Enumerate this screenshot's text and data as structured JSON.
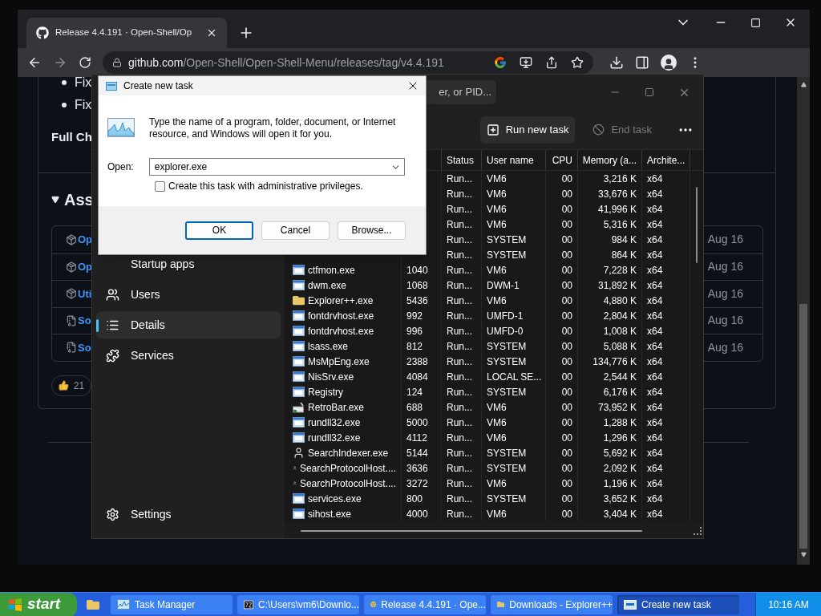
{
  "browser": {
    "tab": {
      "title": "Release 4.4.191 · Open-Shell/Op"
    },
    "url": {
      "host": "github.com",
      "path": "/Open-Shell/Open-Shell-Menu/releases/tag/v4.4.191"
    }
  },
  "github_page": {
    "bullets": [
      "Fix",
      "Fix"
    ],
    "heading": "Full Ch",
    "assets": {
      "title": "Ass",
      "items": [
        {
          "kind": "package",
          "name": "Op",
          "date": "Aug 16"
        },
        {
          "kind": "package",
          "name": "Op",
          "date": "Aug 16"
        },
        {
          "kind": "package",
          "name": "Uti",
          "date": "Aug 16"
        },
        {
          "kind": "archive",
          "name": "So",
          "date": "Aug 16"
        },
        {
          "kind": "archive",
          "name": "So",
          "date": "Aug 16"
        }
      ]
    },
    "reaction": {
      "count": "21"
    }
  },
  "task_manager": {
    "search": {
      "placeholder": "er, or PID..."
    },
    "commands": [
      {
        "kind": "run",
        "label": "Run new task",
        "disabled": false
      },
      {
        "kind": "end",
        "label": "End task",
        "disabled": true
      }
    ],
    "nav": [
      {
        "kind": "startup",
        "label": "Startup apps",
        "selected": false
      },
      {
        "kind": "users",
        "label": "Users",
        "selected": false
      },
      {
        "kind": "details",
        "label": "Details",
        "selected": true
      },
      {
        "kind": "services",
        "label": "Services",
        "selected": false
      }
    ],
    "settings": "Settings",
    "columns": [
      "Status",
      "User name",
      "CPU",
      "Memory (a...",
      "Archite..."
    ],
    "rows": [
      {
        "status": "Run...",
        "user": "VM6",
        "cpu": "00",
        "memory": "3,216 K",
        "arch": "x64"
      },
      {
        "status": "Run...",
        "user": "VM6",
        "cpu": "00",
        "memory": "33,676 K",
        "arch": "x64"
      },
      {
        "status": "Run...",
        "user": "VM6",
        "cpu": "00",
        "memory": "41,996 K",
        "arch": "x64"
      },
      {
        "status": "Run...",
        "user": "VM6",
        "cpu": "00",
        "memory": "5,316 K",
        "arch": "x64"
      },
      {
        "status": "Run...",
        "user": "SYSTEM",
        "cpu": "00",
        "memory": "984 K",
        "arch": "x64"
      },
      {
        "status": "Run...",
        "user": "SYSTEM",
        "cpu": "00",
        "memory": "864 K",
        "arch": "x64"
      },
      {
        "kind": "app",
        "name": "ctfmon.exe",
        "pid": "1040",
        "status": "Run...",
        "user": "VM6",
        "cpu": "00",
        "memory": "7,228 K",
        "arch": "x64"
      },
      {
        "kind": "app",
        "name": "dwm.exe",
        "pid": "1068",
        "status": "Run...",
        "user": "DWM-1",
        "cpu": "00",
        "memory": "31,892 K",
        "arch": "x64"
      },
      {
        "kind": "folder",
        "name": "Explorer++.exe",
        "pid": "5436",
        "status": "Run...",
        "user": "VM6",
        "cpu": "00",
        "memory": "4,880 K",
        "arch": "x64"
      },
      {
        "kind": "app",
        "name": "fontdrvhost.exe",
        "pid": "992",
        "status": "Run...",
        "user": "UMFD-1",
        "cpu": "00",
        "memory": "2,804 K",
        "arch": "x64"
      },
      {
        "kind": "app",
        "name": "fontdrvhost.exe",
        "pid": "996",
        "status": "Run...",
        "user": "UMFD-0",
        "cpu": "00",
        "memory": "1,008 K",
        "arch": "x64"
      },
      {
        "kind": "app",
        "name": "lsass.exe",
        "pid": "812",
        "status": "Run...",
        "user": "SYSTEM",
        "cpu": "00",
        "memory": "5,088 K",
        "arch": "x64"
      },
      {
        "kind": "app",
        "name": "MsMpEng.exe",
        "pid": "2388",
        "status": "Run...",
        "user": "SYSTEM",
        "cpu": "00",
        "memory": "134,776 K",
        "arch": "x64"
      },
      {
        "kind": "app",
        "name": "NisSrv.exe",
        "pid": "4084",
        "status": "Run...",
        "user": "LOCAL SE...",
        "cpu": "00",
        "memory": "2,544 K",
        "arch": "x64"
      },
      {
        "kind": "app",
        "name": "Registry",
        "pid": "124",
        "status": "Run...",
        "user": "SYSTEM",
        "cpu": "00",
        "memory": "6,176 K",
        "arch": "x64"
      },
      {
        "kind": "retrobar",
        "name": "RetroBar.exe",
        "pid": "688",
        "status": "Run...",
        "user": "VM6",
        "cpu": "00",
        "memory": "73,952 K",
        "arch": "x64"
      },
      {
        "kind": "app",
        "name": "rundll32.exe",
        "pid": "5000",
        "status": "Run...",
        "user": "VM6",
        "cpu": "00",
        "memory": "1,288 K",
        "arch": "x64"
      },
      {
        "kind": "app",
        "name": "rundll32.exe",
        "pid": "4112",
        "status": "Run...",
        "user": "VM6",
        "cpu": "00",
        "memory": "1,296 K",
        "arch": "x64"
      },
      {
        "kind": "search",
        "name": "SearchIndexer.exe",
        "pid": "5144",
        "status": "Run...",
        "user": "SYSTEM",
        "cpu": "00",
        "memory": "5,692 K",
        "arch": "x64"
      },
      {
        "kind": "search",
        "name": "SearchProtocolHost....",
        "pid": "3636",
        "status": "Run...",
        "user": "SYSTEM",
        "cpu": "00",
        "memory": "2,092 K",
        "arch": "x64"
      },
      {
        "kind": "search",
        "name": "SearchProtocolHost....",
        "pid": "3272",
        "status": "Run...",
        "user": "VM6",
        "cpu": "00",
        "memory": "1,196 K",
        "arch": "x64"
      },
      {
        "kind": "app",
        "name": "services.exe",
        "pid": "800",
        "status": "Run...",
        "user": "SYSTEM",
        "cpu": "00",
        "memory": "3,652 K",
        "arch": "x64"
      },
      {
        "kind": "app",
        "name": "sihost.exe",
        "pid": "4000",
        "status": "Run...",
        "user": "VM6",
        "cpu": "00",
        "memory": "3,404 K",
        "arch": "x64"
      }
    ]
  },
  "dialog": {
    "title": "Create new task",
    "message": "Type the name of a program, folder, document, or Internet resource, and Windows will open it for you.",
    "open_label": "Open:",
    "open_value": "explorer.exe",
    "admin_checkbox": {
      "label": "Create this task with administrative privileges.",
      "checked": false
    },
    "buttons": [
      {
        "label": "OK",
        "default": true
      },
      {
        "label": "Cancel",
        "default": false
      },
      {
        "label": "Browse...",
        "default": false
      }
    ]
  },
  "taskbar": {
    "start": "start",
    "items": [
      {
        "kind": "taskmgr",
        "label": "Task Manager",
        "selected": false
      },
      {
        "kind": "sevenzip",
        "label": "C:\\Users\\vm6\\Downlo...",
        "selected": false
      },
      {
        "kind": "chrome",
        "label": "Release 4.4.191 · Ope...",
        "selected": false
      },
      {
        "kind": "folder",
        "label": "Downloads - Explorer++",
        "selected": false
      },
      {
        "kind": "dialog",
        "label": "Create new task",
        "selected": true
      }
    ],
    "clock": "10:16 AM"
  }
}
